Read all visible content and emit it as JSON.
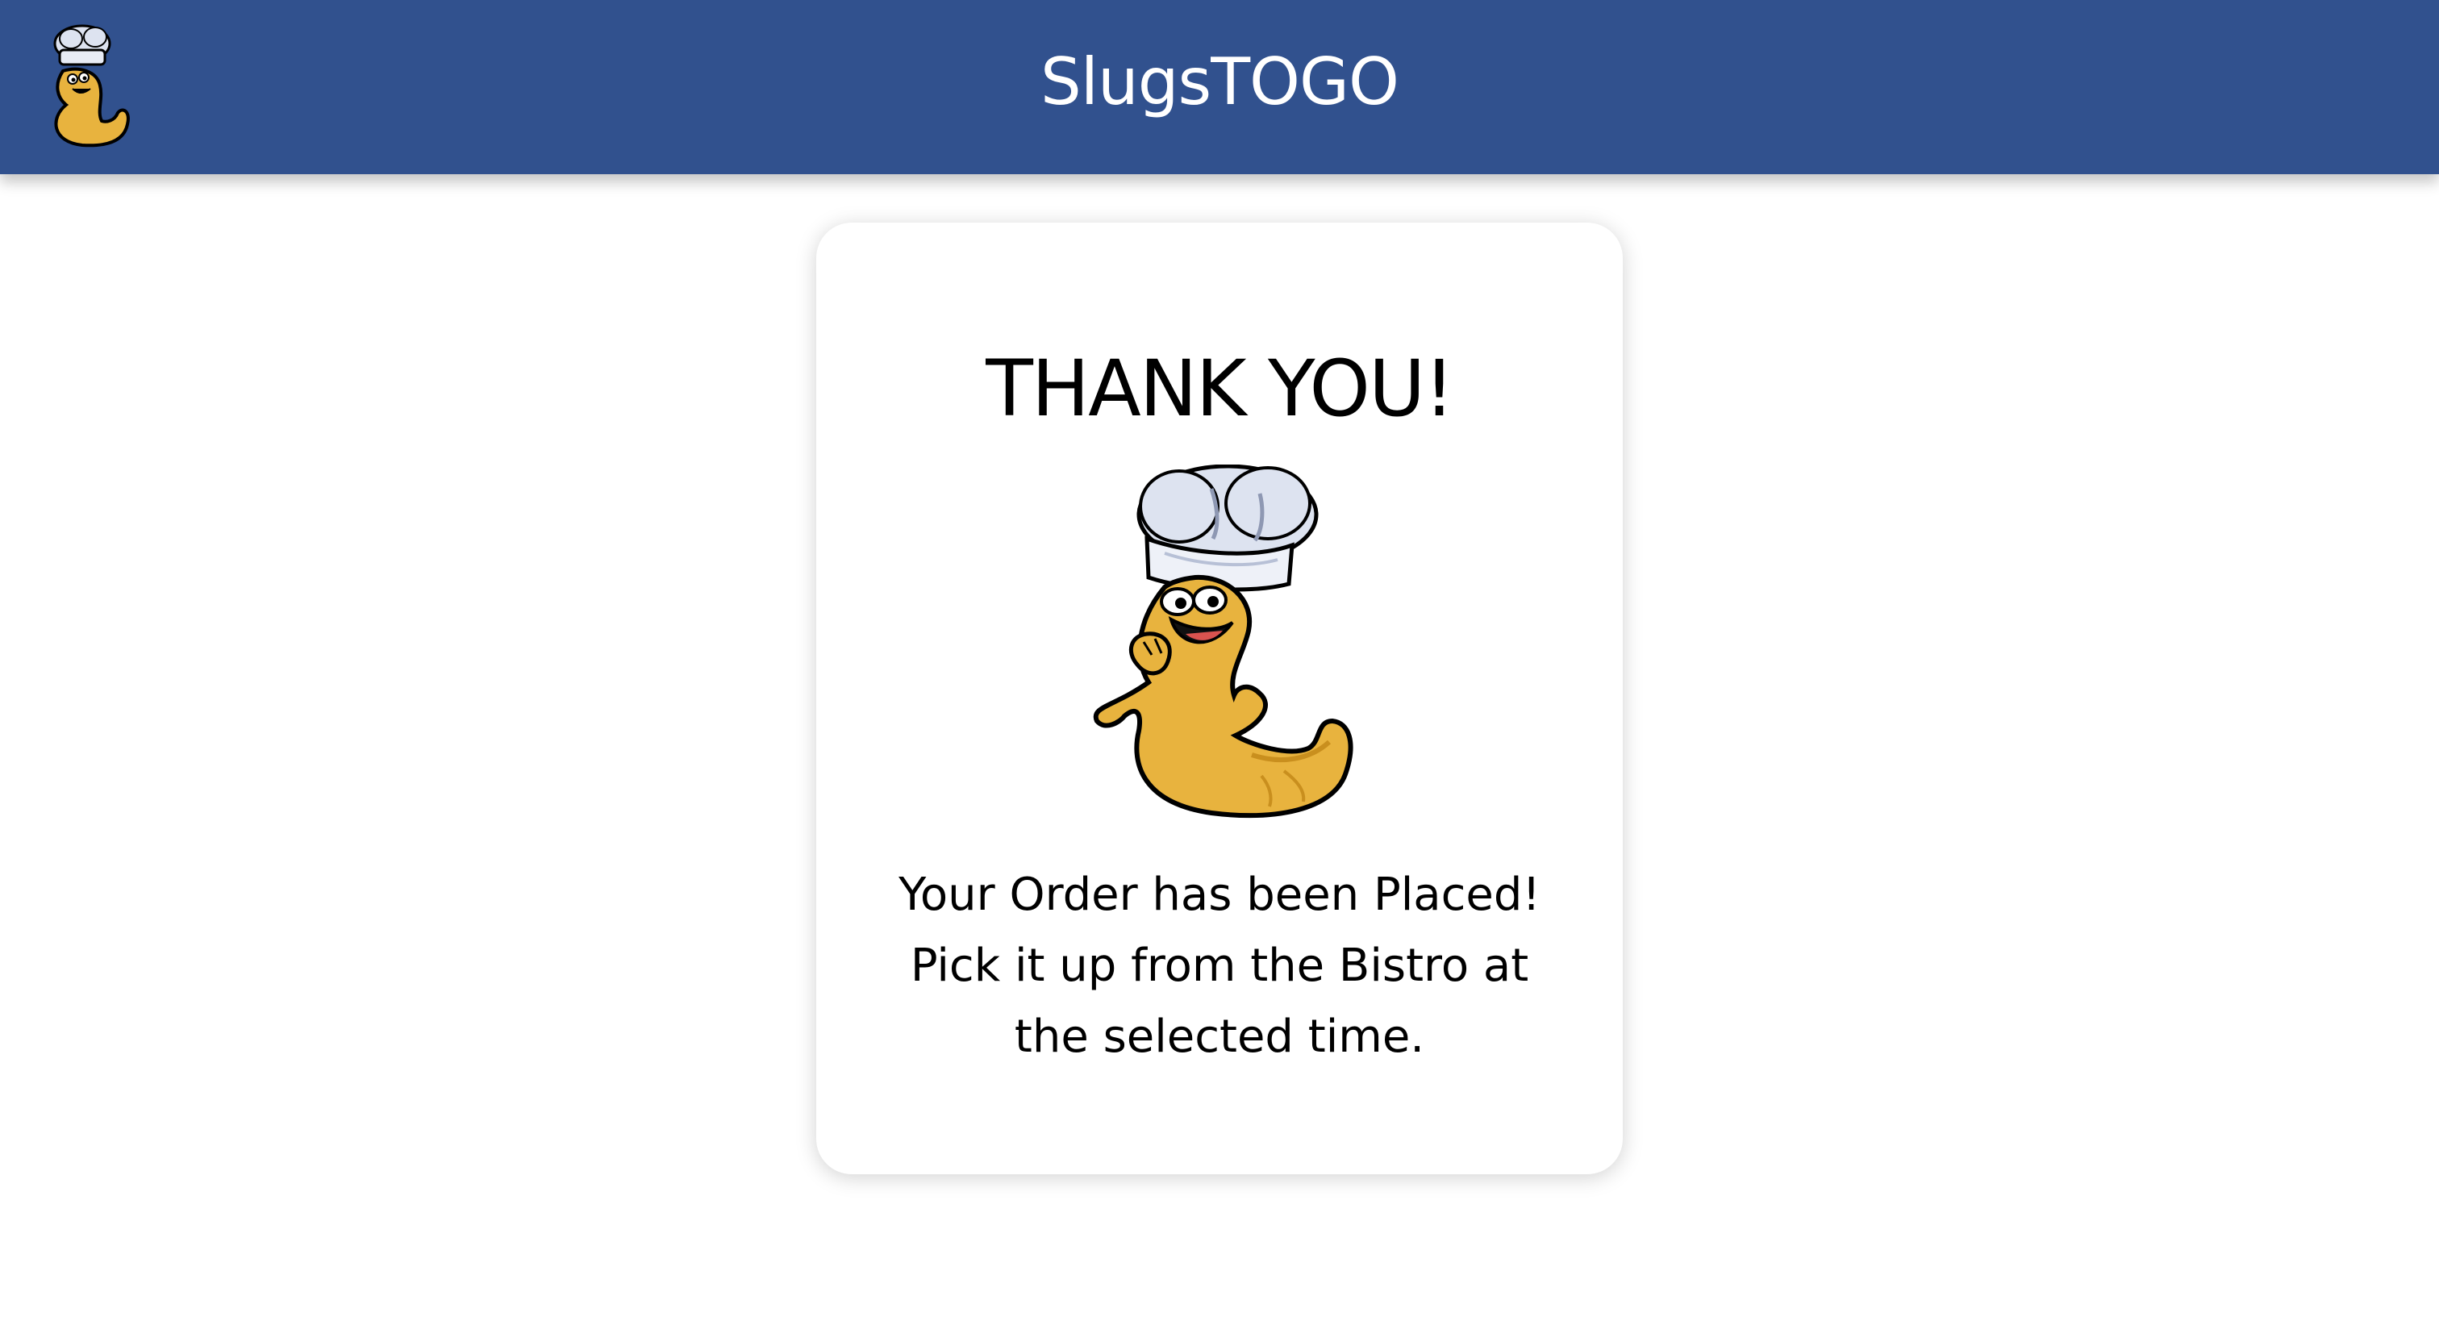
{
  "header": {
    "title": "SlugsTOGO",
    "logo_icon": "slug-chef-logo-icon",
    "background_color": "#31518E"
  },
  "confirmation": {
    "title": "THANK YOU!",
    "mascot_icon": "slug-chef-mascot-icon",
    "message": "Your Order has been Placed! Pick it up from the Bistro at the selected time."
  },
  "colors": {
    "slug_body": "#E8B33E",
    "chef_hat": "#DDE3F0"
  }
}
